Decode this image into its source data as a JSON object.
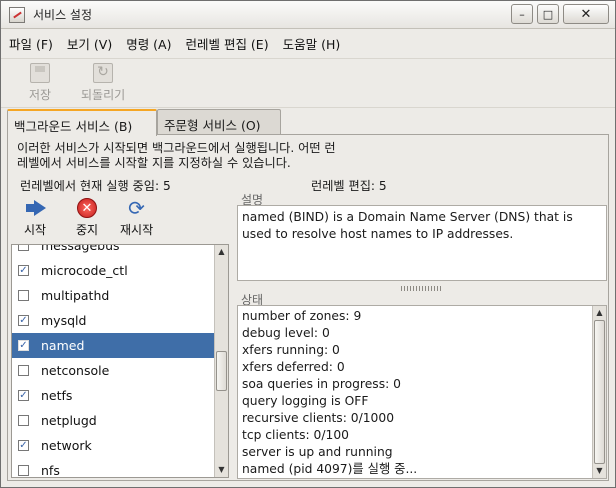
{
  "window": {
    "title": "서비스 설정"
  },
  "menu": [
    "파일 (F)",
    "보기 (V)",
    "명령 (A)",
    "런레벨 편집 (E)",
    "도움말 (H)"
  ],
  "toolbar": {
    "save_label": "저장",
    "revert_label": "되돌리기"
  },
  "tabs": [
    {
      "label": "백그라운드 서비스 (B)",
      "active": true
    },
    {
      "label": "주문형 서비스 (O)",
      "active": false
    }
  ],
  "description_text": [
    "이러한 서비스가 시작되면 백그라운드에서 실행됩니다. 어떤 런",
    "레벨에서 서비스를 시작할 지를 지정하실 수 있습니다."
  ],
  "status_bar": {
    "current_runlevel": "런레벨에서 현재 실행 중임: 5",
    "editing_runlevel": "런레벨 편집: 5"
  },
  "actions": {
    "start": "시작",
    "stop": "중지",
    "restart": "재시작"
  },
  "services": [
    {
      "name": "messagebus",
      "checked": false,
      "selected": false
    },
    {
      "name": "microcode_ctl",
      "checked": true,
      "selected": false
    },
    {
      "name": "multipathd",
      "checked": false,
      "selected": false
    },
    {
      "name": "mysqld",
      "checked": true,
      "selected": false
    },
    {
      "name": "named",
      "checked": true,
      "selected": true
    },
    {
      "name": "netconsole",
      "checked": false,
      "selected": false
    },
    {
      "name": "netfs",
      "checked": true,
      "selected": false
    },
    {
      "name": "netplugd",
      "checked": false,
      "selected": false
    },
    {
      "name": "network",
      "checked": true,
      "selected": false
    },
    {
      "name": "nfs",
      "checked": false,
      "selected": false
    }
  ],
  "description_panel": {
    "label": "설명",
    "text": "named (BIND) is a Domain Name Server (DNS) that is used to resolve host names to IP addresses."
  },
  "status_panel": {
    "label": "상태",
    "lines": [
      "number of zones: 9",
      "debug level: 0",
      "xfers running: 0",
      "xfers deferred: 0",
      "soa queries in progress: 0",
      "query logging is OFF",
      "recursive clients: 0/1000",
      "tcp clients: 0/100",
      "server is up and running",
      "named (pid  4097)를 실행 중..."
    ]
  },
  "colors": {
    "selection": "#3f6ea8",
    "tab_accent": "#f5a624"
  }
}
